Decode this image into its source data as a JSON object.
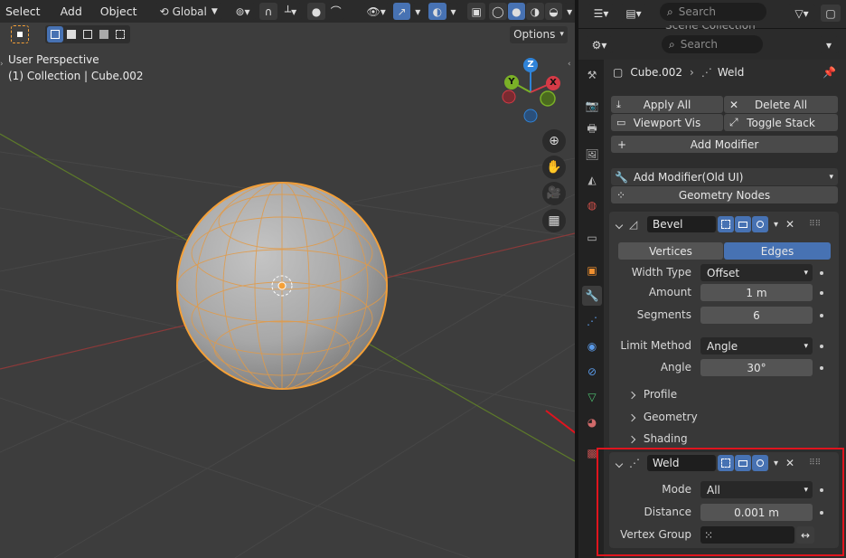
{
  "viewport": {
    "menus": [
      "Select",
      "Add",
      "Object"
    ],
    "orientation": "Global",
    "options_label": "Options",
    "overlay_line1": "User Perspective",
    "overlay_line2": "(1) Collection | Cube.002",
    "gizmo": {
      "z": "Z",
      "y": "Y",
      "x": "X"
    }
  },
  "outliner": {
    "search_placeholder": "Search",
    "partial_text": "Scene Collection"
  },
  "properties": {
    "search_placeholder": "Search",
    "breadcrumb_object": "Cube.002",
    "breadcrumb_modifier": "Weld",
    "apply_all": "Apply All",
    "delete_all": "Delete All",
    "viewport_vis": "Viewport Vis",
    "toggle_stack": "Toggle Stack",
    "add_modifier": "Add Modifier",
    "add_modifier_old": "Add Modifier(Old UI)",
    "geometry_nodes": "Geometry Nodes",
    "bevel": {
      "name": "Bevel",
      "tab_vertices": "Vertices",
      "tab_edges": "Edges",
      "width_type_label": "Width Type",
      "width_type_value": "Offset",
      "amount_label": "Amount",
      "amount_value": "1 m",
      "segments_label": "Segments",
      "segments_value": "6",
      "limit_method_label": "Limit Method",
      "limit_method_value": "Angle",
      "angle_label": "Angle",
      "angle_value": "30°",
      "profile": "Profile",
      "geometry": "Geometry",
      "shading": "Shading"
    },
    "weld": {
      "name": "Weld",
      "mode_label": "Mode",
      "mode_value": "All",
      "distance_label": "Distance",
      "distance_value": "0.001 m",
      "vertex_group_label": "Vertex Group"
    }
  },
  "colors": {
    "highlight": "#e0141e",
    "active_blue": "#4772b3",
    "selection_orange": "#f5a037",
    "gizmo_x": "#d63a46",
    "gizmo_y": "#7ab027",
    "gizmo_z": "#2f83d8"
  }
}
